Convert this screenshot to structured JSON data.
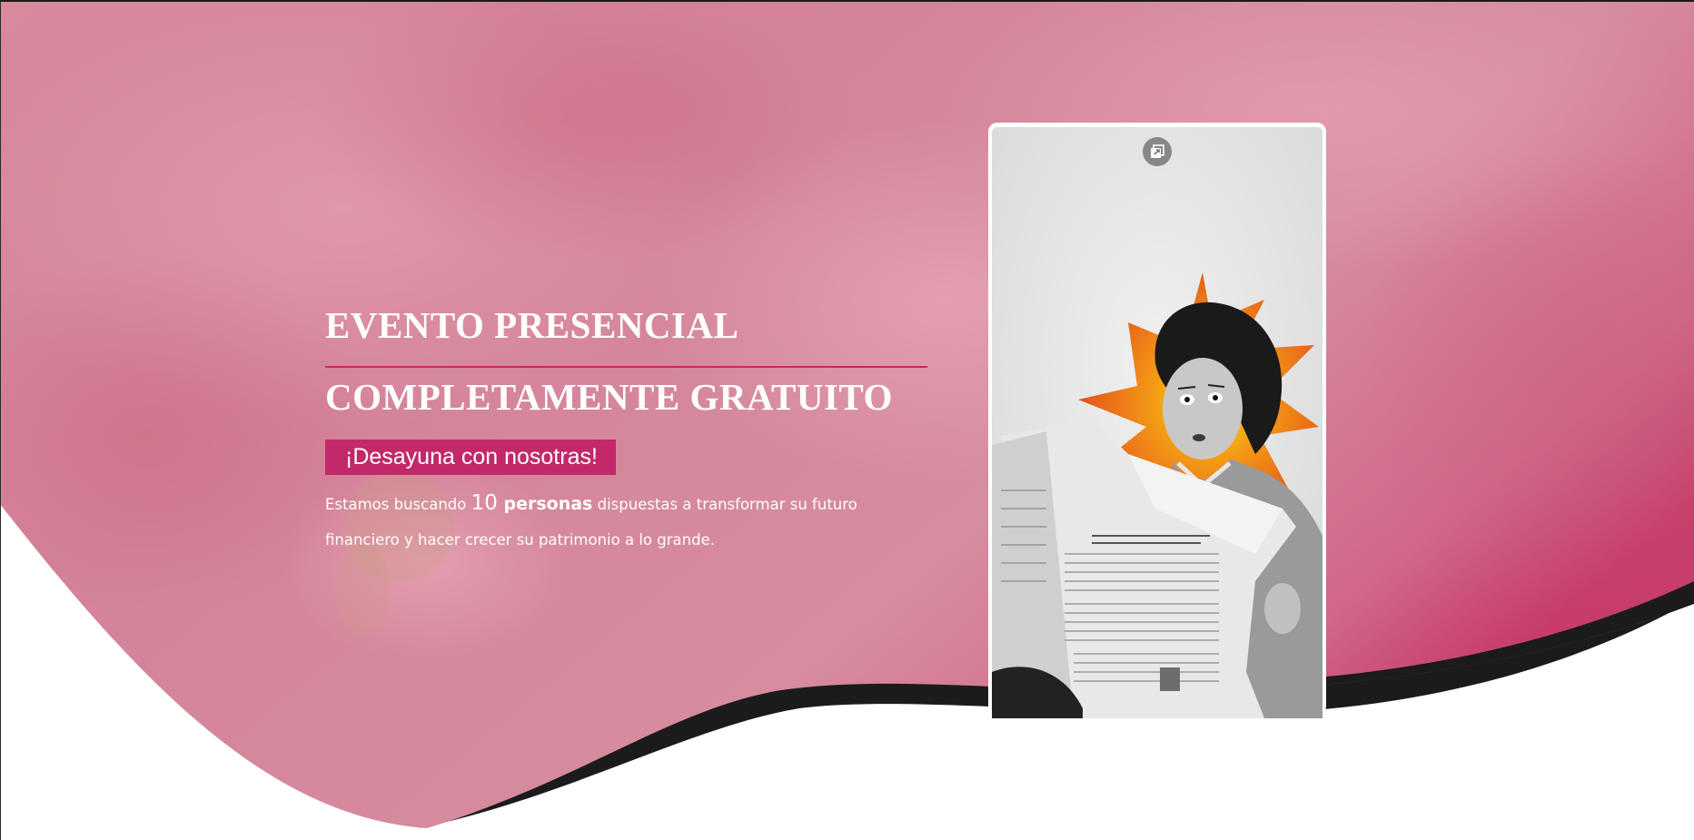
{
  "hero": {
    "heading_line_1": "EVENTO PRESENCIAL",
    "heading_line_2": "COMPLETAMENTE GRATUITO",
    "tagline": "¡Desayuna con nosotras!",
    "description": {
      "part_1": "Estamos buscando ",
      "number": "10",
      "bold": " personas",
      "part_2": " dispuestas a transformar su futuro financiero y hacer crecer su patrimonio a lo grande."
    }
  },
  "video": {
    "expand_icon": "expand-icon"
  },
  "colors": {
    "accent": "#c2286a",
    "divider": "#c22a63",
    "hero_pink": "#d8889b",
    "dark_wave": "#1b1b1b",
    "text": "#ffffff"
  }
}
